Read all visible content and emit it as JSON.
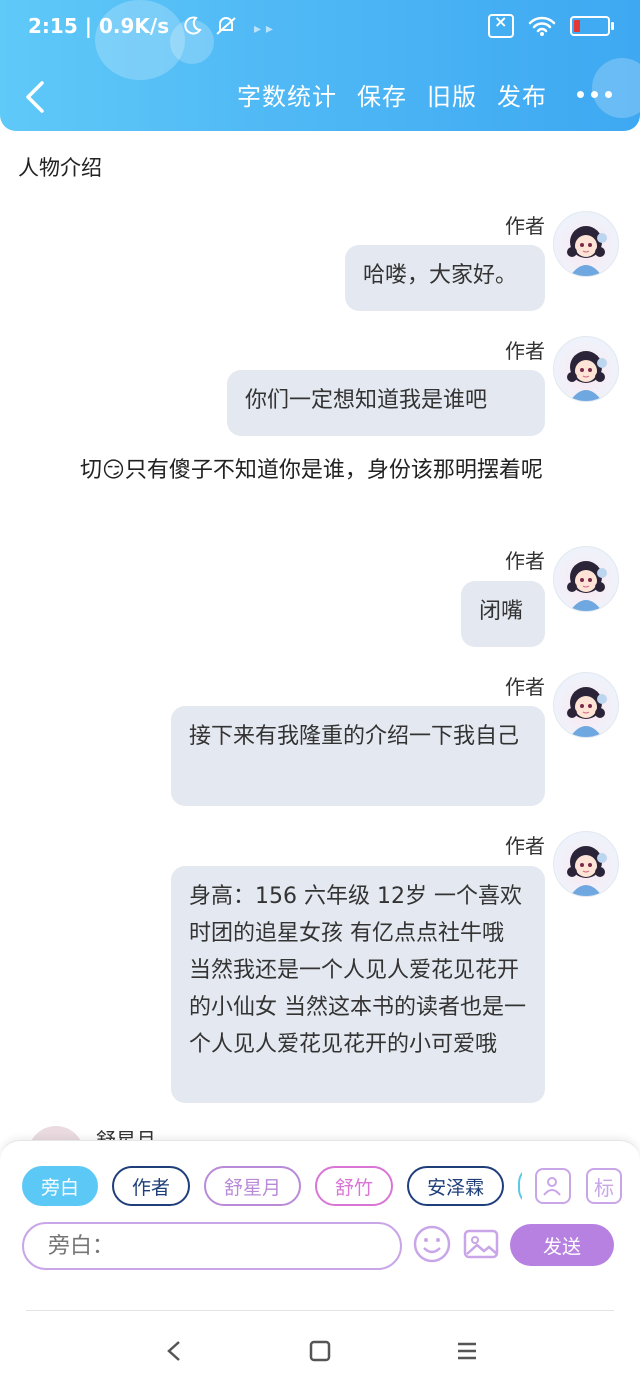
{
  "status_bar": {
    "time_speed": "2:15 | 0.9K/s",
    "icons": [
      "moon-icon",
      "mute-icon",
      "sim-off-icon",
      "wifi-icon",
      "battery-low-icon"
    ]
  },
  "header": {
    "back_icon": "chevron-left-icon",
    "actions": [
      "字数统计",
      "保存",
      "旧版",
      "发布"
    ],
    "more_icon": "more-dots-icon"
  },
  "content": {
    "section_title": "人物介绍",
    "messages": [
      {
        "author": "作者",
        "text": "哈喽，大家好。"
      },
      {
        "author": "作者",
        "text": "你们一定想知道我是谁吧"
      },
      {
        "author": "作者",
        "text": "闭嘴"
      },
      {
        "author": "作者",
        "text": "接下来有我隆重的介绍一下我自己"
      },
      {
        "author": "作者",
        "text": "身高：156 六年级 12岁 一个喜欢时团的追星女孩 有亿点点社牛哦 当然我还是一个人见人爱花见花开的小仙女 当然这本书的读者也是一个人见人爱花见花开的小可爱哦"
      }
    ],
    "narration": "切😏只有傻子不知道你是谁，身份该那明摆着呢",
    "peek_name": "舒星月"
  },
  "bottom": {
    "chips": [
      "旁白",
      "作者",
      "舒星月",
      "舒竹",
      "安泽霖"
    ],
    "tool_label": "标",
    "input_placeholder": "旁白：",
    "send_label": "发送",
    "colors": {
      "active_chip": "#5cc8f6",
      "send": "#b681e0",
      "accent_border": "#c9a6e8"
    }
  },
  "system_nav": [
    "back-triangle-icon",
    "home-square-icon",
    "menu-lines-icon"
  ]
}
